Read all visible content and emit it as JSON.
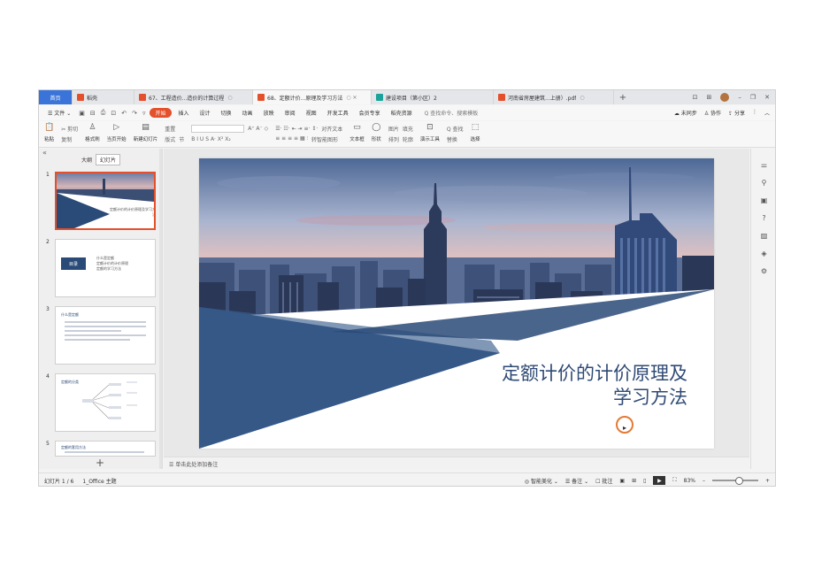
{
  "tabs": [
    {
      "label": "首页",
      "type": "home"
    },
    {
      "label": "稻壳",
      "color": "#e4502b"
    },
    {
      "label": "67、工程造价...造价的计算过程",
      "color": "#e4502b",
      "close": "○"
    },
    {
      "label": "68、定额计价...原理及学习方法",
      "color": "#e4502b",
      "active": true,
      "close": "○ ✕"
    },
    {
      "label": "建设项目（第小区）2",
      "color": "#1aa39a",
      "close": "✕"
    },
    {
      "label": "河南省房屋建筑...上册）.pdf",
      "color": "#e4502b",
      "close": "○"
    }
  ],
  "tab_add": "+",
  "window_controls": {
    "layout": "⊡",
    "grid": "⊞",
    "minimize": "–",
    "restore": "❐",
    "close": "✕"
  },
  "menu": {
    "file": "☰ 文件 ⌄",
    "items": [
      "开始",
      "插入",
      "设计",
      "切换",
      "动画",
      "放映",
      "审阅",
      "视图",
      "开发工具",
      "会员专享",
      "稻壳资源"
    ],
    "search": "Q 查找命令、搜索模板",
    "right": [
      "☁ 未同步",
      "♙ 协作",
      "⇪ 分享",
      "⋮",
      "︿"
    ]
  },
  "ribbon": {
    "paste": "粘贴",
    "cut": "✂ 剪切",
    "copy": "复制",
    "format_painter": "格式刷",
    "start_from_current": "当页开始",
    "new_slide": "新建幻灯片",
    "layout": "版式",
    "section": "节",
    "reset": "重置",
    "text_box": "文本框",
    "shape": "形状",
    "arrange": "排列",
    "outline": "轮廓",
    "picture": "图片",
    "fill": "填充",
    "presenter_tools": "演示工具",
    "find": "Q 查找",
    "replace": "替换",
    "select": "选择",
    "align_text": "对齐文本",
    "smart_shape": "转智能图形"
  },
  "left_panel": {
    "collapse": "«",
    "tabs": [
      "大纲",
      "幻灯片"
    ],
    "active_tab": "幻灯片",
    "thumbs": [
      {
        "num": "1",
        "title": "定额计价的计价原理及学习方法"
      },
      {
        "num": "2",
        "title": "目录",
        "items": [
          "什么是定额",
          "定额计价的计价原理",
          "定额的学习方法"
        ]
      },
      {
        "num": "3",
        "title": "什么是定额"
      },
      {
        "num": "4",
        "title": "定额的分类"
      },
      {
        "num": "5",
        "title": "定额的套用方法"
      }
    ],
    "add": "+"
  },
  "slide": {
    "title_line1": "定额计价的计价原理及",
    "title_line2": "学习方法",
    "colors": {
      "dark": "#2a4a78",
      "mid": "#3c5f8f",
      "light": "#d8dde6"
    }
  },
  "notes_placeholder": "单击此处添加备注",
  "status": {
    "slide_index": "幻灯片 1 / 6",
    "theme": "1_Office 主题",
    "beautify": "◎ 智能美化 ⌄",
    "notes": "☰ 备注 ⌄",
    "comments": "☐ 批注",
    "zoom": "83%",
    "zoom_out": "–",
    "zoom_in": "+"
  }
}
